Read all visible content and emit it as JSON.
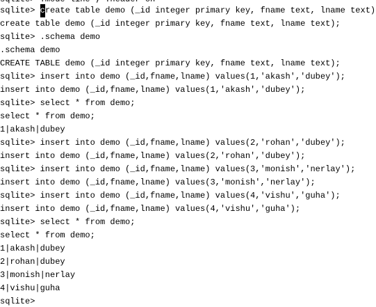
{
  "terminal": {
    "partial_top_line": "sqlite> .mode line ; .header on",
    "prompt": "sqlite> ",
    "cursor_char": "c",
    "first_command_rest": "reate table demo (_id integer primary key, fname text, lname text);",
    "lines": [
      "create table demo (_id integer primary key, fname text, lname text);",
      "sqlite> .schema demo",
      ".schema demo",
      "CREATE TABLE demo (_id integer primary key, fname text, lname text);",
      "sqlite> insert into demo (_id,fname,lname) values(1,'akash','dubey');",
      "insert into demo (_id,fname,lname) values(1,'akash','dubey');",
      "sqlite> select * from demo;",
      "select * from demo;",
      "1|akash|dubey",
      "sqlite> insert into demo (_id,fname,lname) values(2,'rohan','dubey');",
      "insert into demo (_id,fname,lname) values(2,'rohan','dubey');",
      "sqlite> insert into demo (_id,fname,lname) values(3,'monish','nerlay');",
      "insert into demo (_id,fname,lname) values(3,'monish','nerlay');",
      "sqlite> insert into demo (_id,fname,lname) values(4,'vishu','guha');",
      "insert into demo (_id,fname,lname) values(4,'vishu','guha');",
      "sqlite> select * from demo;",
      "select * from demo;",
      "1|akash|dubey",
      "2|rohan|dubey",
      "3|monish|nerlay",
      "4|vishu|guha",
      "sqlite>"
    ]
  }
}
